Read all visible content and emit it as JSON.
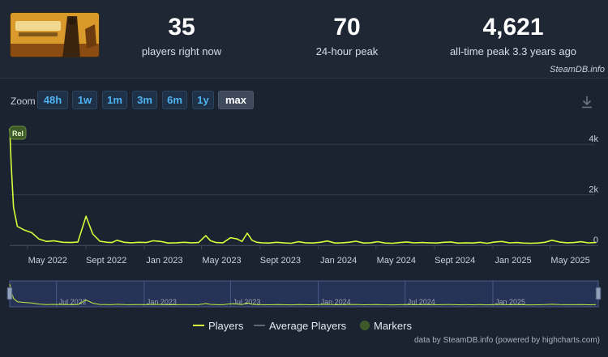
{
  "stats": [
    {
      "value": "35",
      "label": "players right now"
    },
    {
      "value": "70",
      "label": "24-hour peak"
    },
    {
      "value": "4,621",
      "label": "all-time peak 3.3 years ago"
    }
  ],
  "source": "SteamDB.info",
  "zoom": {
    "label": "Zoom",
    "buttons": [
      "48h",
      "1w",
      "1m",
      "3m",
      "6m",
      "1y",
      "max"
    ],
    "active": "max"
  },
  "marker_label": "Rel",
  "credit": "data by SteamDB.info (powered by highcharts.com)",
  "colors": {
    "series": "#d4ff3a",
    "average": "#5e6878",
    "marker": "#3c5a2a",
    "navigator_bg": "#2b3a66",
    "accent": "#4fb3f3"
  },
  "chart_data": {
    "type": "line",
    "ylim": [
      0,
      5000
    ],
    "yticks": [
      {
        "value": 0,
        "label": "0"
      },
      {
        "value": 2000,
        "label": "2k"
      },
      {
        "value": 4000,
        "label": "4k"
      }
    ],
    "xlim": [
      "2022-03-25",
      "2025-08-10"
    ],
    "xticks": [
      {
        "date": "2022-05-01",
        "label": "May 2022"
      },
      {
        "date": "2022-09-01",
        "label": "Sept 2022"
      },
      {
        "date": "2023-01-01",
        "label": "Jan 2023"
      },
      {
        "date": "2023-05-01",
        "label": "May 2023"
      },
      {
        "date": "2023-09-01",
        "label": "Sept 2023"
      },
      {
        "date": "2024-01-01",
        "label": "Jan 2024"
      },
      {
        "date": "2024-05-01",
        "label": "May 2024"
      },
      {
        "date": "2024-09-01",
        "label": "Sept 2024"
      },
      {
        "date": "2025-01-01",
        "label": "Jan 2025"
      },
      {
        "date": "2025-05-01",
        "label": "May 2025"
      }
    ],
    "navigator_ticks": [
      {
        "date": "2022-07-01",
        "label": "Jul 2022"
      },
      {
        "date": "2023-01-01",
        "label": "Jan 2023"
      },
      {
        "date": "2023-07-01",
        "label": "Jul 2023"
      },
      {
        "date": "2024-01-01",
        "label": "Jan 2024"
      },
      {
        "date": "2024-07-01",
        "label": "Jul 2024"
      },
      {
        "date": "2025-01-01",
        "label": "Jan 2025"
      }
    ],
    "markers": [
      {
        "date": "2022-03-25",
        "label": "Rel"
      }
    ],
    "series": [
      {
        "name": "Players",
        "color": "#d4ff3a",
        "x": [
          "2022-03-25",
          "2022-03-28",
          "2022-04-02",
          "2022-04-10",
          "2022-04-25",
          "2022-05-10",
          "2022-05-25",
          "2022-06-10",
          "2022-06-25",
          "2022-07-15",
          "2022-08-01",
          "2022-08-15",
          "2022-09-01",
          "2022-09-15",
          "2022-09-30",
          "2022-10-15",
          "2022-10-25",
          "2022-11-05",
          "2022-11-20",
          "2022-12-05",
          "2022-12-20",
          "2023-01-05",
          "2023-01-20",
          "2023-02-05",
          "2023-02-20",
          "2023-03-10",
          "2023-03-25",
          "2023-04-10",
          "2023-04-25",
          "2023-05-10",
          "2023-05-20",
          "2023-06-01",
          "2023-06-15",
          "2023-07-01",
          "2023-07-15",
          "2023-07-25",
          "2023-08-05",
          "2023-08-15",
          "2023-08-25",
          "2023-09-05",
          "2023-09-20",
          "2023-10-05",
          "2023-10-20",
          "2023-11-05",
          "2023-11-20",
          "2023-12-05",
          "2023-12-20",
          "2024-01-05",
          "2024-01-20",
          "2024-02-05",
          "2024-02-20",
          "2024-03-05",
          "2024-03-20",
          "2024-04-05",
          "2024-04-20",
          "2024-05-05",
          "2024-05-20",
          "2024-06-05",
          "2024-06-20",
          "2024-07-05",
          "2024-07-20",
          "2024-08-05",
          "2024-08-20",
          "2024-09-05",
          "2024-09-20",
          "2024-10-05",
          "2024-10-20",
          "2024-11-05",
          "2024-11-20",
          "2024-12-05",
          "2024-12-20",
          "2025-01-05",
          "2025-01-20",
          "2025-02-05",
          "2025-02-20",
          "2025-03-05",
          "2025-03-20",
          "2025-04-05",
          "2025-04-20",
          "2025-05-05",
          "2025-05-20",
          "2025-06-05",
          "2025-06-20",
          "2025-07-05",
          "2025-07-20",
          "2025-08-05"
        ],
        "values": [
          4621,
          3200,
          1500,
          750,
          600,
          500,
          250,
          150,
          180,
          120,
          110,
          130,
          1150,
          450,
          160,
          120,
          110,
          200,
          120,
          100,
          120,
          110,
          180,
          150,
          90,
          100,
          120,
          100,
          110,
          380,
          180,
          110,
          100,
          300,
          250,
          150,
          480,
          200,
          120,
          100,
          90,
          120,
          100,
          80,
          140,
          100,
          90,
          120,
          170,
          90,
          100,
          120,
          160,
          90,
          100,
          140,
          90,
          80,
          110,
          130,
          95,
          110,
          100,
          90,
          120,
          130,
          85,
          100,
          90,
          120,
          80,
          130,
          150,
          95,
          110,
          90,
          80,
          90,
          120,
          200,
          130,
          100,
          110,
          140,
          95,
          110
        ]
      },
      {
        "name": "Average Players",
        "color": "#5e6878",
        "x": [],
        "values": []
      },
      {
        "name": "Markers",
        "color": "#3c5a2a",
        "x": [],
        "values": []
      }
    ]
  }
}
